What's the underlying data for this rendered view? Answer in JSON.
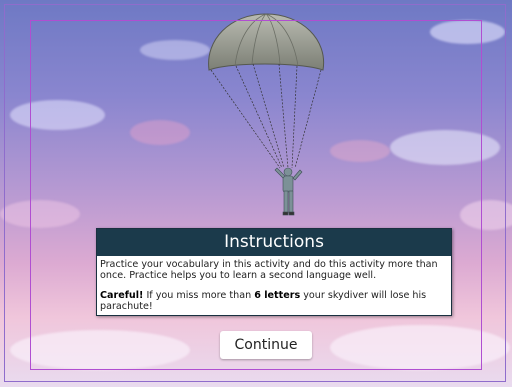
{
  "dialog": {
    "title": "Instructions",
    "text1": "Practice your vocabulary in this activity and do this activity more than once. Practice helps you to learn a second language well.",
    "careful": "Careful!",
    "text2_a": " If you miss more than ",
    "emphasis": "6 letters",
    "text2_b": " your skydiver will lose his parachute!"
  },
  "continue_label": "Continue",
  "colors": {
    "dialog_header": "#1b3a4b",
    "sky_top": "#6e79c4",
    "sky_bottom": "#e9dbef",
    "frame": "#b04ed1"
  },
  "icons": [
    "parachute-icon",
    "skydiver-icon"
  ]
}
